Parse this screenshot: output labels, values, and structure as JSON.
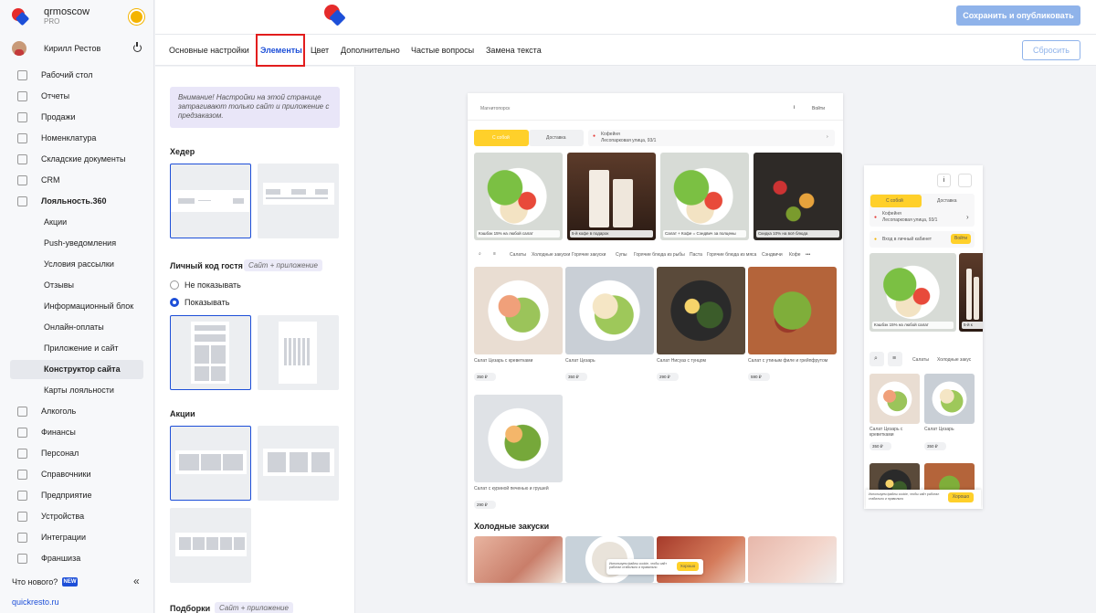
{
  "sidebar": {
    "brand": "qrmoscow",
    "plan": "PRO",
    "user": "Кирилл Рестов",
    "items": [
      {
        "label": "Рабочий стол"
      },
      {
        "label": "Отчеты"
      },
      {
        "label": "Продажи"
      },
      {
        "label": "Номенклатура"
      },
      {
        "label": "Складские документы"
      },
      {
        "label": "CRM"
      },
      {
        "label": "Лояльность.360"
      }
    ],
    "sub_items": [
      {
        "label": "Акции"
      },
      {
        "label": "Push-уведомления"
      },
      {
        "label": "Условия рассылки"
      },
      {
        "label": "Отзывы"
      },
      {
        "label": "Информационный блок"
      },
      {
        "label": "Онлайн-оплаты"
      },
      {
        "label": "Приложение и сайт"
      },
      {
        "label": "Конструктор сайта"
      },
      {
        "label": "Карты лояльности"
      }
    ],
    "items_bottom": [
      {
        "label": "Алкоголь"
      },
      {
        "label": "Финансы"
      },
      {
        "label": "Персонал"
      },
      {
        "label": "Справочники"
      },
      {
        "label": "Предприятие"
      },
      {
        "label": "Устройства"
      },
      {
        "label": "Интеграции"
      },
      {
        "label": "Франшиза"
      }
    ],
    "whats_new": "Что нового?",
    "new_badge": "NEW",
    "footer_link": "quickresto.ru"
  },
  "topbar": {
    "publish_label": "Сохранить и опубликовать",
    "reset_label": "Сбросить"
  },
  "tabs": [
    {
      "label": "Основные настройки"
    },
    {
      "label": "Элементы"
    },
    {
      "label": "Цвет"
    },
    {
      "label": "Дополнительно"
    },
    {
      "label": "Частые вопросы"
    },
    {
      "label": "Замена текста"
    }
  ],
  "panel": {
    "notice": "Внимание! Настройки на этой странице затрагивают только сайт и приложение с предзаказом.",
    "header_title": "Хедер",
    "guest_code_title": "Личный код гостя",
    "guest_code_chip": "Сайт + приложение",
    "radio_hide": "Не показывать",
    "radio_show": "Показывать",
    "promos_title": "Акции",
    "selections_title": "Подборки",
    "selections_chip": "Сайт + приложение"
  },
  "preview": {
    "desktop": {
      "brand": "Магнитопорск",
      "login": "Войти",
      "tab_pickup": "С собой",
      "tab_delivery": "Доставка",
      "place_name": "Кофейня",
      "place_address": "Лесопарковая улица, 93/1",
      "promos": [
        "Кэшбэк 15% на любой салат",
        "5-й кофе в подарок",
        "Салат + Кофе = Сэндвич за полцены",
        "Скидка 10% на всё блюда"
      ],
      "categories": [
        "Салаты",
        "Холодные закуски",
        "Горячие закуски",
        "Супы",
        "Горячие блюда из рыбы",
        "Паста",
        "Горячие блюда из мяса",
        "Сэндвичи",
        "Кофе",
        "•••"
      ],
      "products": [
        {
          "name": "Салат Цезарь с креветками",
          "price": "350 ₽"
        },
        {
          "name": "Салат Цезарь",
          "price": "350 ₽"
        },
        {
          "name": "Салат Нисуаз с тунцом",
          "price": "290 ₽"
        },
        {
          "name": "Салат с утиным филе и грейпфрутом",
          "price": "590 ₽"
        },
        {
          "name": "Салат с куриной печенью и грушей",
          "price": "290 ₽"
        }
      ],
      "section_cold": "Холодные закуски",
      "cookie_text": "Используем файлы cookie, чтобы сайт работал стабильно и правильно",
      "cookie_btn": "Хорошо"
    },
    "mobile": {
      "tab_pickup": "С собой",
      "tab_delivery": "Доставка",
      "place_name": "Кофейня",
      "place_address": "Лесопарковая улица, 93/1",
      "login_text": "Вход в личный кабинет",
      "login_btn": "Войти",
      "promo": "Кэшбэк 15% на любой салат",
      "promo2": "5-й к",
      "categories": [
        "Салаты",
        "Холодные закус"
      ],
      "products": [
        {
          "name": "Салат Цезарь с креветками",
          "price": "350 ₽"
        },
        {
          "name": "Салат Цезарь",
          "price": "350 ₽"
        }
      ],
      "cookie_text": "Используем файлы cookie, чтобы сайт работал стабильно и правильно",
      "cookie_btn": "Хорошо"
    }
  }
}
